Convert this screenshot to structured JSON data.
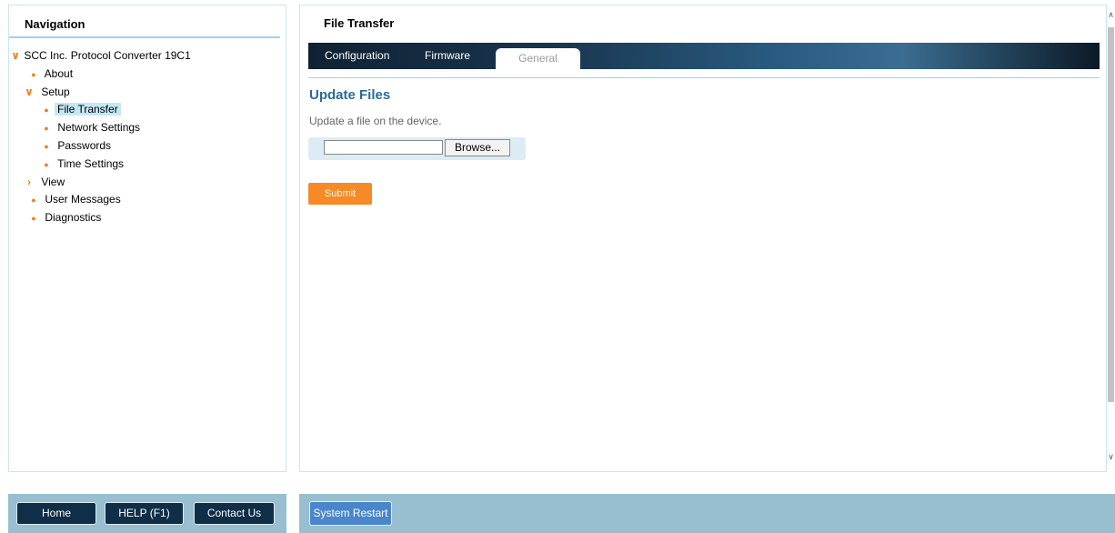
{
  "navigation": {
    "title": "Navigation",
    "items": [
      {
        "label": "SCC Inc. Protocol Converter 19C1",
        "marker": "chevron-down-icon"
      },
      {
        "label": "About",
        "marker": "bullet-icon"
      },
      {
        "label": "Setup",
        "marker": "chevron-down-icon"
      },
      {
        "label": "File Transfer",
        "marker": "bullet-icon",
        "selected": true
      },
      {
        "label": "Network Settings",
        "marker": "bullet-icon"
      },
      {
        "label": "Passwords",
        "marker": "bullet-icon"
      },
      {
        "label": "Time Settings",
        "marker": "bullet-icon"
      },
      {
        "label": "View",
        "marker": "chevron-right-icon"
      },
      {
        "label": "User Messages",
        "marker": "bullet-icon"
      },
      {
        "label": "Diagnostics",
        "marker": "bullet-icon"
      }
    ]
  },
  "content": {
    "title": "File Transfer",
    "tabs": [
      {
        "label": "Configuration"
      },
      {
        "label": "Firmware"
      },
      {
        "label": "General",
        "active": true
      }
    ],
    "section_heading": "Update Files",
    "section_desc": "Update a file on the device.",
    "file_input_value": "",
    "browse_label": "Browse...",
    "submit_label": "Submit"
  },
  "footer": {
    "home_label": "Home",
    "help_label": "HELP (F1)",
    "contact_label": "Contact Us",
    "restart_label": "System Restart"
  },
  "colors": {
    "accent_orange": "#f68a26",
    "tree_marker_orange": "#f47f20",
    "heading_blue": "#2a6b95",
    "footer_bg": "#98bfd0",
    "dark_button": "#0f2e47",
    "restart_button": "#4a86cc"
  }
}
